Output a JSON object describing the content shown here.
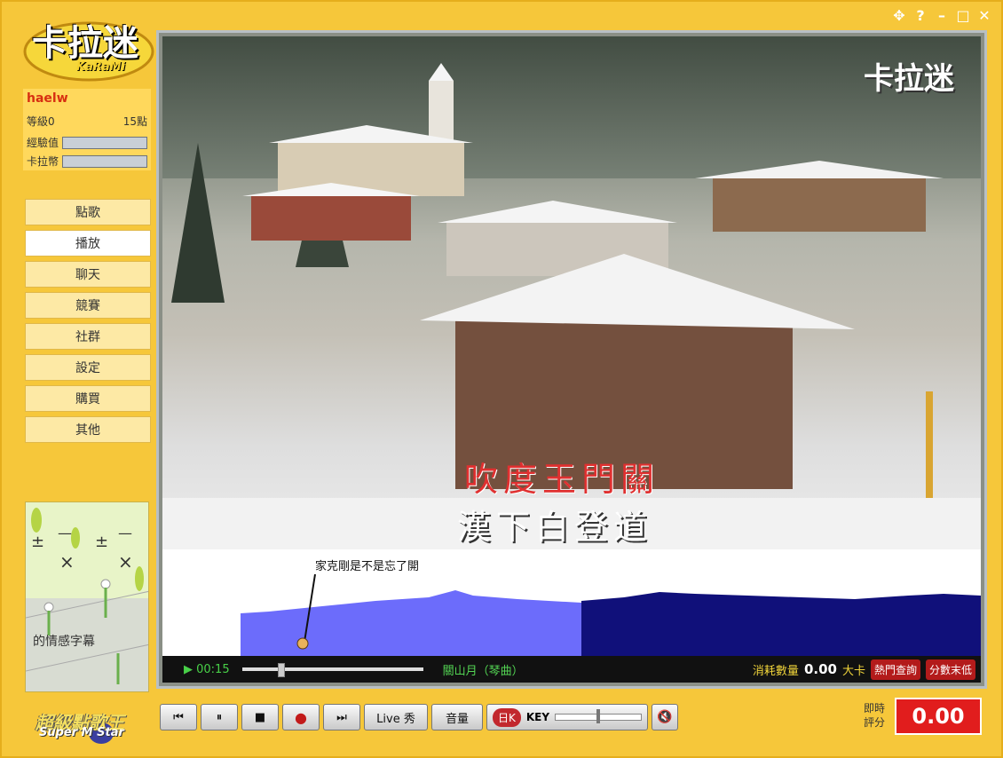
{
  "window": {
    "controls": [
      "✥",
      "?",
      "–",
      "□",
      "✕"
    ]
  },
  "logo": {
    "text": "卡拉迷",
    "sub": "KaRaMi"
  },
  "user": {
    "name": "haelw",
    "level_label": "等級0",
    "points": "15點",
    "exp_label": "經驗值",
    "kara_label": "卡拉幣"
  },
  "menu": {
    "items": [
      {
        "label": "點歌"
      },
      {
        "label": "播放"
      },
      {
        "label": "聊天"
      },
      {
        "label": "競賽"
      },
      {
        "label": "社群"
      },
      {
        "label": "設定"
      },
      {
        "label": "購買"
      },
      {
        "label": "其他"
      }
    ],
    "active_index": 1
  },
  "ad": {
    "caption": "的情感字幕"
  },
  "brand": {
    "text": "超級點歌王",
    "sub": "Super M Star"
  },
  "video": {
    "scene_logo": "卡拉迷",
    "lyric_line1": "吹度玉門關",
    "lyric_line2": "漢下白登道",
    "pitch_comment": "家克剛是不是忘了開"
  },
  "status": {
    "time": "▶ 00:15",
    "song": "關山月（琴曲）",
    "cost_label": "消耗數量",
    "cost_value": "0.00",
    "cost_unit": "大卡",
    "btn_hot": "熱門查詢",
    "btn_score": "分數末低"
  },
  "controls": {
    "prev": "⏮",
    "pause": "⏸",
    "stop": "■",
    "record": "●",
    "next": "⏭",
    "live": "Live 秀",
    "volume": "音量",
    "key_chip": "日K",
    "key_label": "KEY",
    "mute": "🔇"
  },
  "score": {
    "label": "即時評分",
    "value": "0.00"
  },
  "colors": {
    "frame": "#f6c73a",
    "pitch_light": "#6c6cfb",
    "pitch_dark": "#10107a",
    "score_bg": "#e11d1d",
    "lyric_red": "#e03030"
  }
}
